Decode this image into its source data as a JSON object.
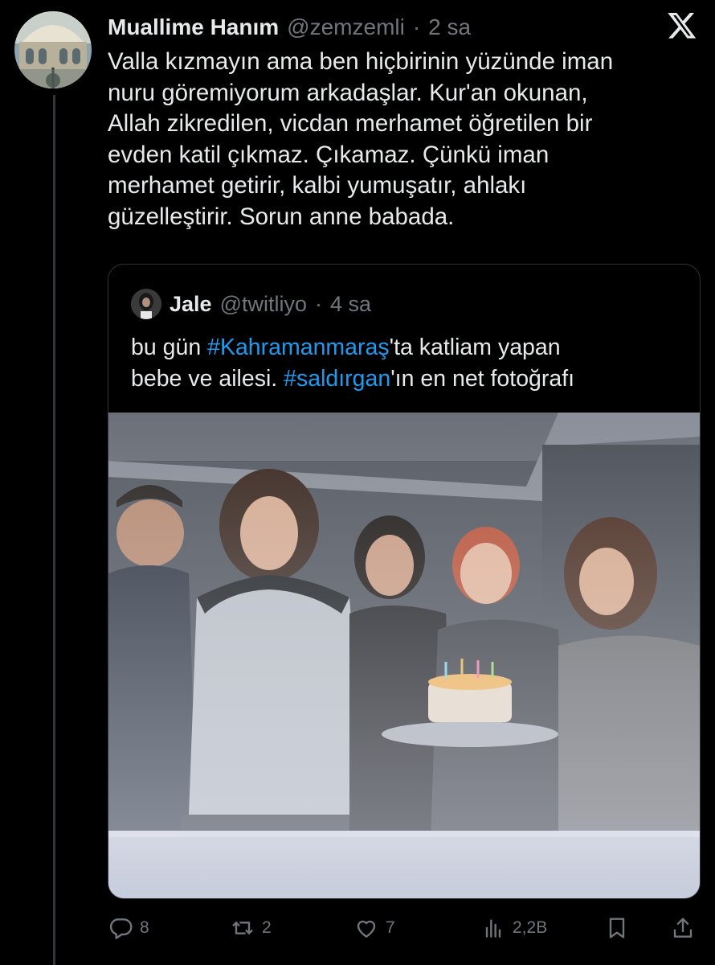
{
  "author": {
    "display_name": "Muallime Hanım",
    "handle": "@zemzemli",
    "separator": "·",
    "time": "2 sa"
  },
  "tweet": {
    "lines": [
      "Valla kızmayın ama ben hiçbirinin yüzünde iman",
      "nuru göremiyorum arkadaşlar. Kur'an okunan,",
      "Allah zikredilen, vicdan merhamet öğretilen bir",
      "evden katil çıkmaz. Çıkamaz. Çünkü iman",
      "merhamet getirir, kalbi yumuşatır, ahlakı",
      "güzelleştirir. Sorun anne babada."
    ]
  },
  "quote": {
    "display_name": "Jale",
    "handle": "@twitliyo",
    "separator": "·",
    "time": "4 sa",
    "line1_pre": "bu gün ",
    "line1_hashtag": "#Kahramanmaraş",
    "line1_post": "'ta katliam yapan",
    "line2_pre": "bebe ve ailesi. ",
    "line2_hashtag": "#saldırgan",
    "line2_post": "'ın en net fotoğrafı"
  },
  "actions": {
    "replies": "8",
    "reposts": "2",
    "likes": "7",
    "views": "2,2B"
  },
  "icons": {
    "platform_logo": "x-logo-icon",
    "reply": "reply-icon",
    "repost": "repost-icon",
    "like": "heart-icon",
    "views": "views-icon",
    "bookmark": "bookmark-icon",
    "share": "share-icon"
  },
  "colors": {
    "background": "#000000",
    "text": "#e7e9ea",
    "muted": "#71767b",
    "hashtag": "#1d9bf0",
    "border": "#2f3336"
  }
}
